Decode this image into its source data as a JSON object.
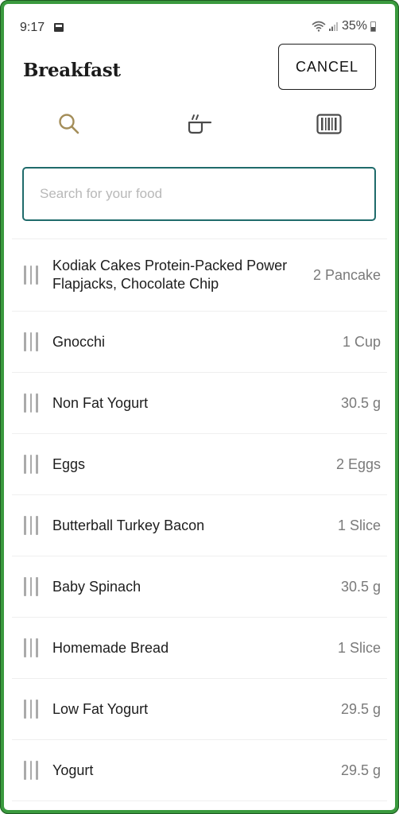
{
  "status_bar": {
    "time": "9:17",
    "battery": "35%",
    "icons": [
      "image-icon",
      "wifi-icon",
      "signal-icon",
      "battery-icon"
    ]
  },
  "header": {
    "title": "Breakfast",
    "cancel_label": "CANCEL"
  },
  "mode_tabs": [
    {
      "name": "search",
      "icon": "search-icon",
      "active": true
    },
    {
      "name": "recipes",
      "icon": "cooking-pot-icon",
      "active": false
    },
    {
      "name": "barcode",
      "icon": "barcode-icon",
      "active": false
    }
  ],
  "search": {
    "placeholder": "Search for your food",
    "value": ""
  },
  "foods": [
    {
      "name": "Kodiak Cakes Protein-Packed Power Flapjacks, Chocolate Chip",
      "amount": "2 Pancake"
    },
    {
      "name": "Gnocchi",
      "amount": "1 Cup"
    },
    {
      "name": "Non Fat Yogurt",
      "amount": "30.5 g"
    },
    {
      "name": "Eggs",
      "amount": "2 Eggs"
    },
    {
      "name": "Butterball Turkey Bacon",
      "amount": "1 Slice"
    },
    {
      "name": "Baby Spinach",
      "amount": "30.5 g"
    },
    {
      "name": "Homemade Bread",
      "amount": "1 Slice"
    },
    {
      "name": "Low Fat Yogurt",
      "amount": "29.5 g"
    },
    {
      "name": "Yogurt",
      "amount": "29.5 g"
    }
  ],
  "colors": {
    "active_tab": "#a48e5a",
    "inactive_tab": "#4a4a4a",
    "search_border": "#1f6b6b",
    "frame_border": "#3a9a3e"
  }
}
